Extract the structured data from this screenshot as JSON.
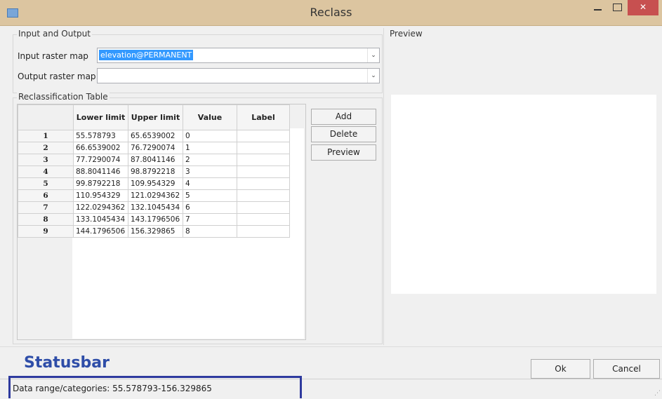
{
  "window": {
    "title": "Reclass"
  },
  "io": {
    "group_label": "Input and Output",
    "input_label": "Input raster map",
    "input_value": "elevation@PERMANENT",
    "output_label": "Output raster map",
    "output_value": ""
  },
  "reclass": {
    "group_label": "Reclassification Table",
    "columns": [
      "Lower limit",
      "Upper limit",
      "Value",
      "Label"
    ],
    "rows": [
      {
        "n": "1",
        "lower": "55.578793",
        "upper": "65.6539002",
        "value": "0",
        "label": ""
      },
      {
        "n": "2",
        "lower": "66.6539002",
        "upper": "76.7290074",
        "value": "1",
        "label": ""
      },
      {
        "n": "3",
        "lower": "77.7290074",
        "upper": "87.8041146",
        "value": "2",
        "label": ""
      },
      {
        "n": "4",
        "lower": "88.8041146",
        "upper": "98.8792218",
        "value": "3",
        "label": ""
      },
      {
        "n": "5",
        "lower": "99.8792218",
        "upper": "109.954329",
        "value": "4",
        "label": ""
      },
      {
        "n": "6",
        "lower": "110.954329",
        "upper": "121.0294362",
        "value": "5",
        "label": ""
      },
      {
        "n": "7",
        "lower": "122.0294362",
        "upper": "132.1045434",
        "value": "6",
        "label": ""
      },
      {
        "n": "8",
        "lower": "133.1045434",
        "upper": "143.1796506",
        "value": "7",
        "label": ""
      },
      {
        "n": "9",
        "lower": "144.1796506",
        "upper": "156.329865",
        "value": "8",
        "label": ""
      }
    ]
  },
  "buttons": {
    "add": "Add",
    "delete": "Delete",
    "preview": "Preview",
    "ok": "Ok",
    "cancel": "Cancel"
  },
  "preview": {
    "group_label": "Preview"
  },
  "statusbar": {
    "annotation": "Statusbar",
    "text": "Data range/categories: 55.578793-156.329865"
  },
  "colors": {
    "titlebar": "#dcc5a0",
    "close_button": "#c75050",
    "selection": "#3399ff",
    "annotation": "#2e3a9e"
  },
  "icons": [
    "app-icon",
    "minimize-icon",
    "maximize-icon",
    "close-icon",
    "chevron-down-icon"
  ]
}
